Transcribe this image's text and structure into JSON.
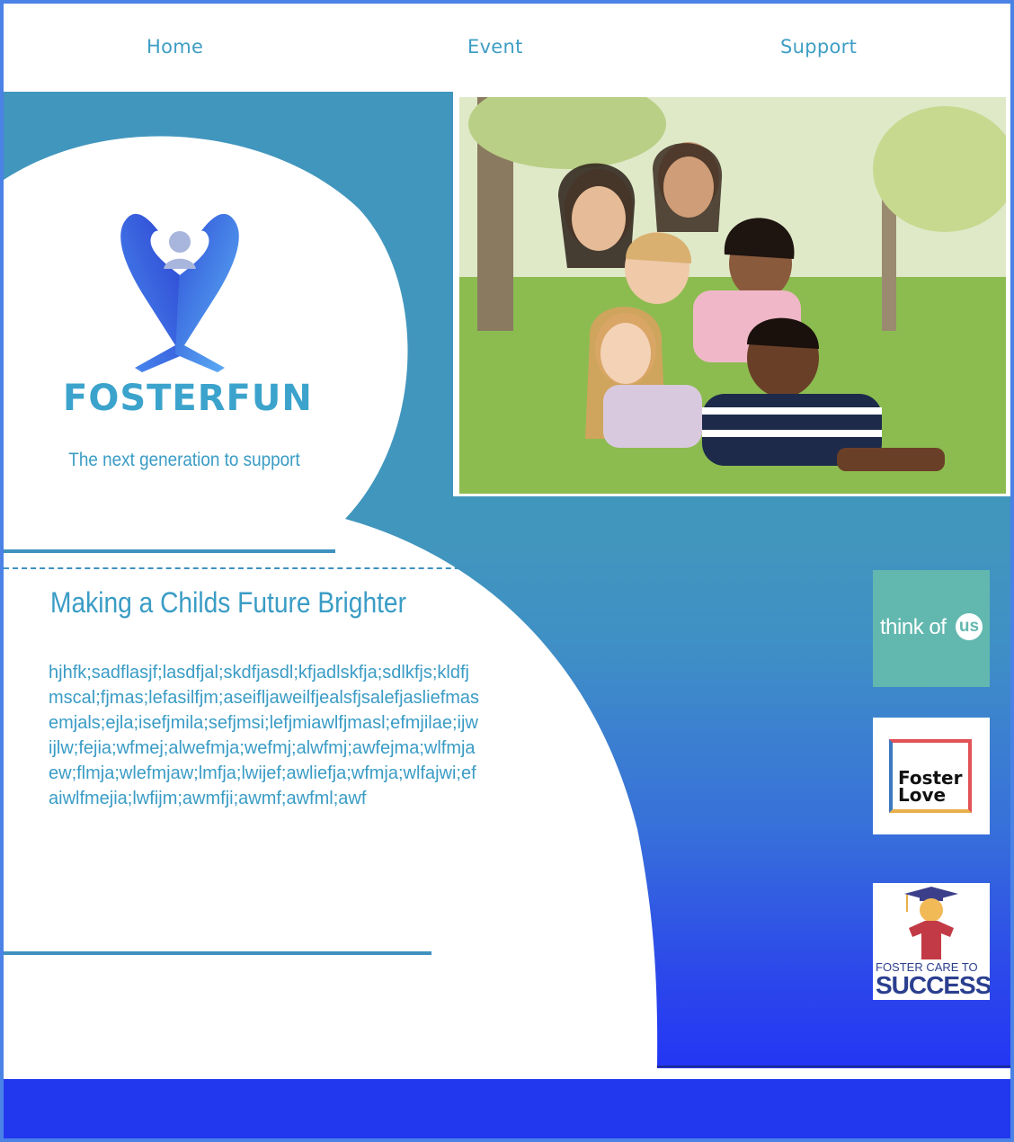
{
  "nav": {
    "home": "Home",
    "event": "Event",
    "support": "Support"
  },
  "brand": {
    "name": "FOSTERFUN",
    "tagline": "The next generation to support"
  },
  "hero_image": {
    "subject": "group of smiling children lying on grass"
  },
  "main": {
    "heading": "Making a Childs Future Brighter",
    "body": "hjhfk;sadflasjf;lasdfjal;skdfjasdl;kfjadlskfja;sdlkfjs;kldfjmscal;fjmas;lefasilfjm;aseifljaweilfjealsfjsalefjasliefmasemjals;ejla;isefjmila;sefjmsi;lefjmiawlfjmasl;efmjilae;ijwijlw;fejia;wfmej;alwefmja;wefmj;alwfmj;awfejma;wlfmjaew;flmja;wlefmjaw;lmfja;lwijef;awliefja;wfmja;wlfajwi;efaiwlfmejia;lwfijm;awmfji;awmf;awfml;awf"
  },
  "partners": [
    {
      "text_a": "think of",
      "text_b": "us"
    },
    {
      "line1": "Foster",
      "line2": "Love"
    },
    {
      "line1": "FOSTER CARE TO",
      "line2": "SUCCESS"
    }
  ],
  "colors": {
    "accent": "#3a9cc5",
    "hero_top": "#4196bd",
    "hero_bottom": "#2336f5",
    "footer": "#2238ee",
    "frame": "#4a82e6"
  }
}
